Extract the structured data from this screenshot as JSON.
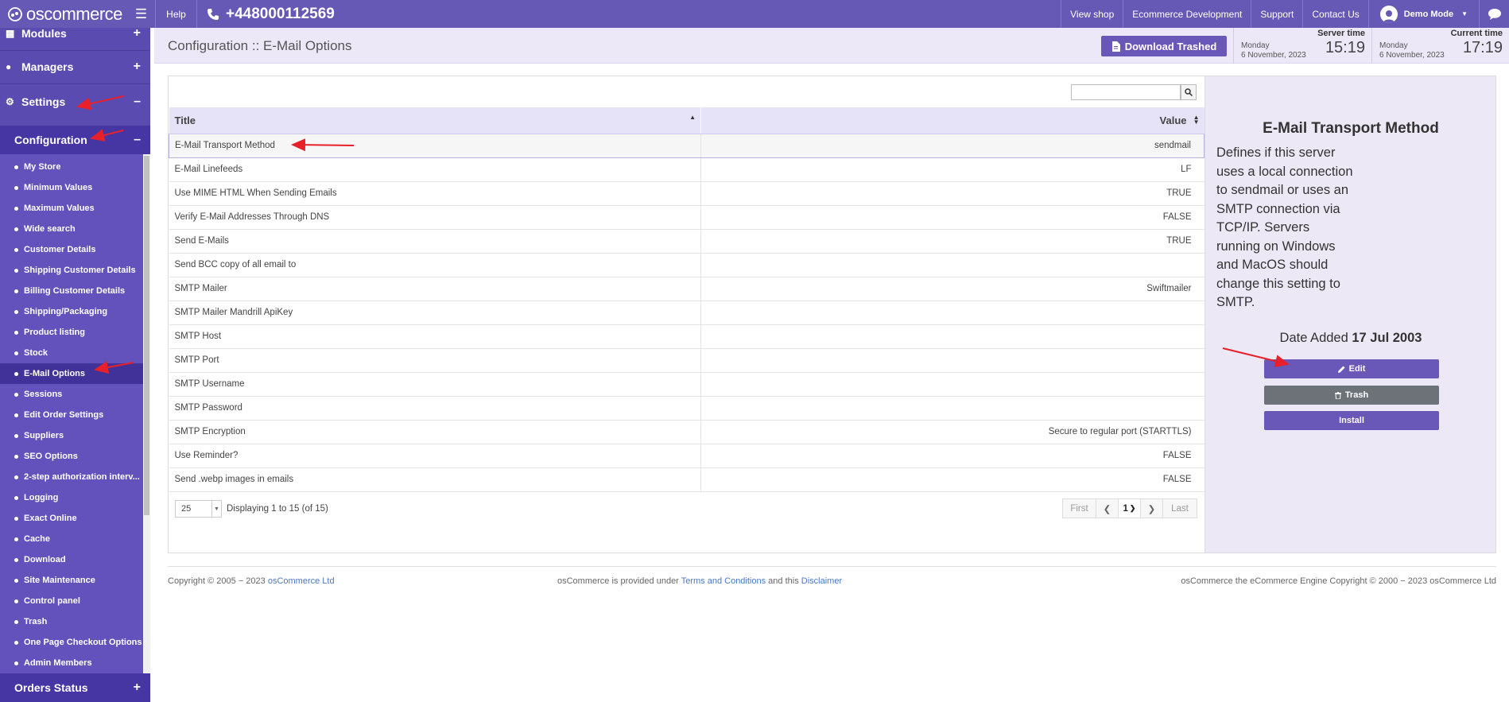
{
  "topbar": {
    "logo_text": "oscommerce",
    "help_label": "Help",
    "phone": "+448000112569",
    "nav": [
      "View shop",
      "Ecommerce Development",
      "Support",
      "Contact Us"
    ],
    "user_label": "Demo Mode"
  },
  "sidebar": {
    "modules_label": "Modules",
    "managers_label": "Managers",
    "settings_label": "Settings",
    "configuration_label": "Configuration",
    "items": [
      "My Store",
      "Minimum Values",
      "Maximum Values",
      "Wide search",
      "Customer Details",
      "Shipping Customer Details",
      "Billing Customer Details",
      "Shipping/Packaging",
      "Product listing",
      "Stock",
      "E-Mail Options",
      "Sessions",
      "Edit Order Settings",
      "Suppliers",
      "SEO Options",
      "2-step authorization interv...",
      "Logging",
      "Exact Online",
      "Cache",
      "Download",
      "Site Maintenance",
      "Control panel",
      "Trash",
      "One Page Checkout Options",
      "Admin Members"
    ],
    "active_item": "E-Mail Options",
    "orders_status_label": "Orders Status"
  },
  "header": {
    "title": "Configuration :: E-Mail Options",
    "download_trashed_label": "Download Trashed",
    "server_time": {
      "label": "Server time",
      "day": "Monday",
      "date": "6 November, 2023",
      "time": "15:19"
    },
    "current_time": {
      "label": "Current time",
      "day": "Monday",
      "date": "6 November, 2023",
      "time": "17:19"
    }
  },
  "table": {
    "search_placeholder": "",
    "columns": [
      "Title",
      "Value"
    ],
    "rows": [
      {
        "title": "E-Mail Transport Method",
        "value": "sendmail"
      },
      {
        "title": "E-Mail Linefeeds",
        "value": "LF"
      },
      {
        "title": "Use MIME HTML When Sending Emails",
        "value": "TRUE"
      },
      {
        "title": "Verify E-Mail Addresses Through DNS",
        "value": "FALSE"
      },
      {
        "title": "Send E-Mails",
        "value": "TRUE"
      },
      {
        "title": "Send BCC copy of all email to",
        "value": ""
      },
      {
        "title": "SMTP Mailer",
        "value": "Swiftmailer"
      },
      {
        "title": "SMTP Mailer Mandrill ApiKey",
        "value": ""
      },
      {
        "title": "SMTP Host",
        "value": ""
      },
      {
        "title": "SMTP Port",
        "value": ""
      },
      {
        "title": "SMTP Username",
        "value": ""
      },
      {
        "title": "SMTP Password",
        "value": ""
      },
      {
        "title": "SMTP Encryption",
        "value": "Secure to regular port (STARTTLS)"
      },
      {
        "title": "Use Reminder?",
        "value": "FALSE"
      },
      {
        "title": "Send .webp images in emails",
        "value": "FALSE"
      }
    ],
    "per_page": "25",
    "displaying": "Displaying 1 to 15 (of 15)",
    "pager": {
      "first": "First",
      "page": "1",
      "last": "Last"
    }
  },
  "info": {
    "title": "E-Mail Transport Method",
    "description": "Defines if this server uses a local connection to sendmail or uses an SMTP connection via TCP/IP. Servers running on Windows and MacOS should change this setting to SMTP.",
    "date_added_label": "Date Added",
    "date_added": "17 Jul 2003",
    "edit_label": "Edit",
    "trash_label": "Trash",
    "install_label": "Install"
  },
  "footer": {
    "copyright_prefix": "Copyright © 2005 − 2023",
    "copyright_link": "osCommerce Ltd",
    "center_prefix": "osCommerce is provided under",
    "terms_link": "Terms and Conditions",
    "center_mid": "and this",
    "disclaimer_link": "Disclaimer",
    "right_text": "osCommerce the eCommerce Engine Copyright © 2000 − 2023 osCommerce Ltd"
  },
  "colors": {
    "topbar": "#6658b5",
    "sidebar": "#5a4bb0",
    "accent_button": "#6a58b9",
    "trash_button": "#6d7279",
    "info_panel": "#ece8f6",
    "annotation_arrow": "#e8202a"
  }
}
